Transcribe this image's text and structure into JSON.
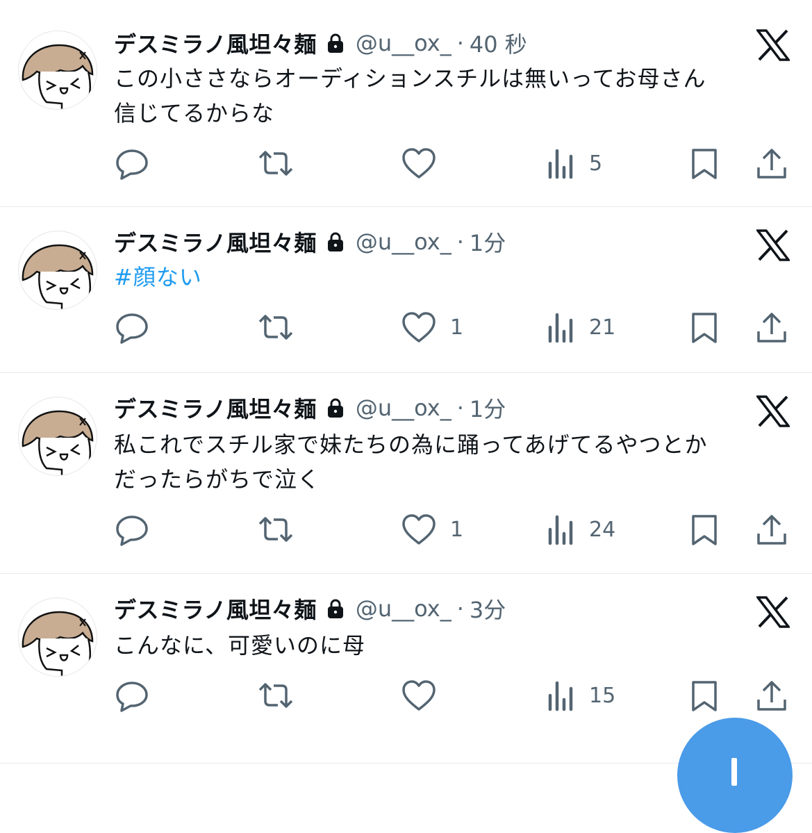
{
  "tweets": [
    {
      "display_name": "デスミラノ風坦々麺",
      "handle": "@u__ox_",
      "separator": "·",
      "time": "40 秒",
      "lines": [
        "この小ささならオーディションスチルは無いってお母さん",
        "信じてるからな"
      ],
      "hashtag": "",
      "replies": "",
      "retweets": "",
      "likes": "",
      "views": "5"
    },
    {
      "display_name": "デスミラノ風坦々麺",
      "handle": "@u__ox_",
      "separator": "·",
      "time": "1分",
      "lines": [],
      "hashtag": "#顔ない",
      "replies": "",
      "retweets": "",
      "likes": "1",
      "views": "21"
    },
    {
      "display_name": "デスミラノ風坦々麺",
      "handle": "@u__ox_",
      "separator": "·",
      "time": "1分",
      "lines": [
        "私これでスチル家で妹たちの為に踊ってあげてるやつとか",
        "だったらがちで泣く"
      ],
      "hashtag": "",
      "replies": "",
      "retweets": "",
      "likes": "1",
      "views": "24"
    },
    {
      "display_name": "デスミラノ風坦々麺",
      "handle": "@u__ox_",
      "separator": "·",
      "time": "3分",
      "lines": [
        "こんなに、可愛いのに母"
      ],
      "hashtag": "",
      "replies": "",
      "retweets": "",
      "likes": "",
      "views": "15"
    }
  ],
  "icons": {
    "avatar": "avatar-illustration",
    "protected": "lock-icon",
    "brand": "x-logo-icon",
    "reply": "reply-icon",
    "retweet": "retweet-icon",
    "like": "heart-icon",
    "views": "views-icon",
    "bookmark": "bookmark-icon",
    "share": "share-icon",
    "compose": "compose-fab"
  },
  "colors": {
    "text": "#0f1419",
    "secondary": "#536471",
    "link": "#1d9bf0",
    "fab": "#4a9be8",
    "divider": "#e7e9ec"
  }
}
